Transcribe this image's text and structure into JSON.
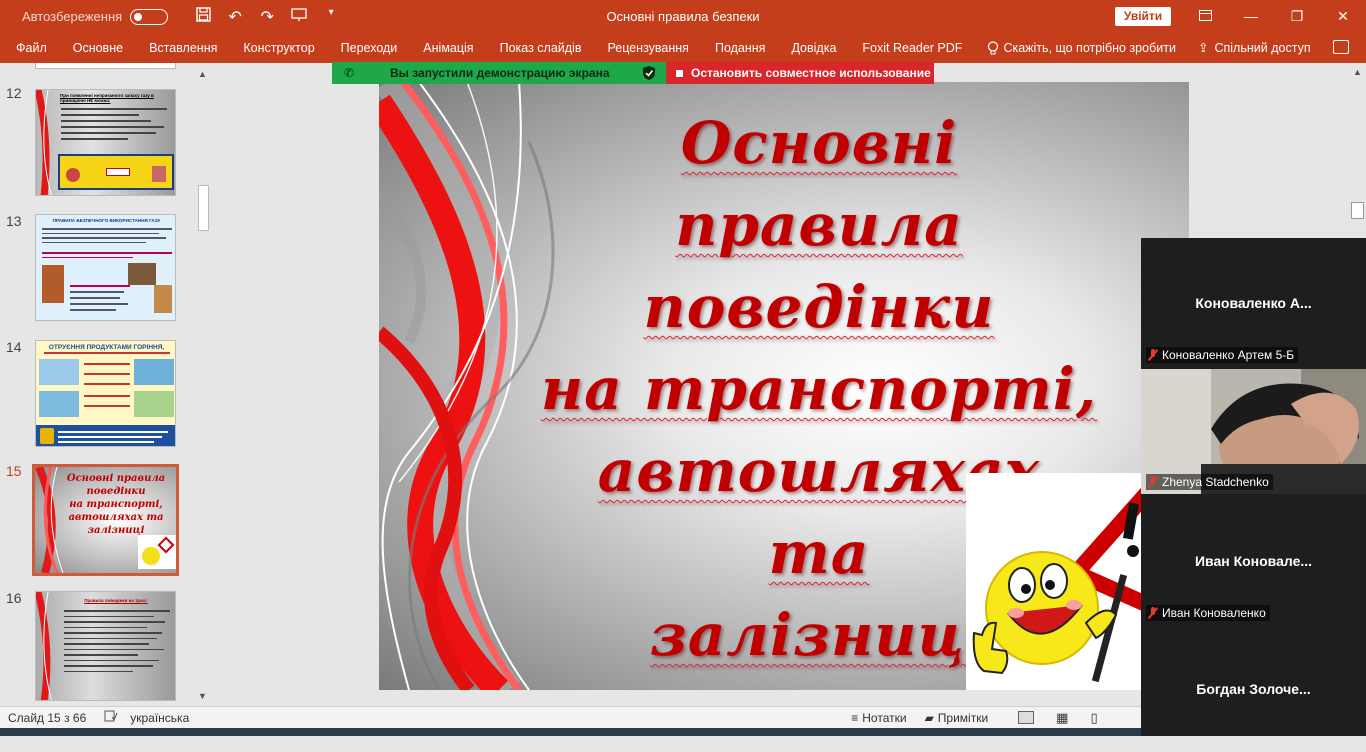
{
  "titlebar": {
    "autosave_label": "Автозбереження",
    "document_title": "Основні правила безпеки",
    "signin_label": "Увійти"
  },
  "ribbon": {
    "tabs": [
      "Файл",
      "Основне",
      "Вставлення",
      "Конструктор",
      "Переходи",
      "Анімація",
      "Показ слайдів",
      "Рецензування",
      "Подання",
      "Довідка",
      "Foxit Reader PDF"
    ],
    "tell_me": "Скажіть, що потрібно зробити",
    "share": "Спільний доступ"
  },
  "thumbnails": [
    {
      "number": "12",
      "active": false
    },
    {
      "number": "13",
      "active": false
    },
    {
      "number": "14",
      "active": false
    },
    {
      "number": "15",
      "active": true
    },
    {
      "number": "16",
      "active": false
    }
  ],
  "thumb_text": {
    "t12_heading": "При появленні неприємного запаху газу в приміщенні НЕ можна:",
    "t13_heading": "ПРАВИЛА БЕЗПЕЧНОГО ВИКОРИСТАННЯ ГАЗУ",
    "t14_heading": "ОТРУЄННЯ ПРОДУКТАМИ ГОРІННЯ,",
    "t15_title": [
      "Основні правила",
      "поведінки",
      "на транспорті,",
      "автошляхах та",
      "залізниці"
    ],
    "t16_heading": "Правила поведінки на трасі:"
  },
  "screenshare": {
    "notice": "Вы запустили демонстрацию экрана",
    "stop": "Остановить совместное использование"
  },
  "slide": {
    "title_lines": [
      "Основні  правила",
      "поведінки",
      "на  транспорті,",
      "автошляхах  та",
      "залізниці"
    ]
  },
  "participants": [
    {
      "big_name": "Коноваленко  А...",
      "small_name": "Коноваленко Артем 5-Б",
      "video": false
    },
    {
      "big_name": "",
      "small_name": "Zhenya Stadchenko",
      "video": true
    },
    {
      "big_name": "Иван  Коновале...",
      "small_name": "Иван Коноваленко",
      "video": false
    },
    {
      "big_name": "Богдан  Золоче...",
      "small_name": "",
      "video": false
    }
  ],
  "statusbar": {
    "slide_info": "Слайд 15 з 66",
    "language": "українська",
    "notes": "Нотатки",
    "comments": "Примітки"
  },
  "colors": {
    "accent": "#c43e1c",
    "share_green": "#1ea84a",
    "share_red": "#d8262b",
    "title_red": "#c00000"
  }
}
